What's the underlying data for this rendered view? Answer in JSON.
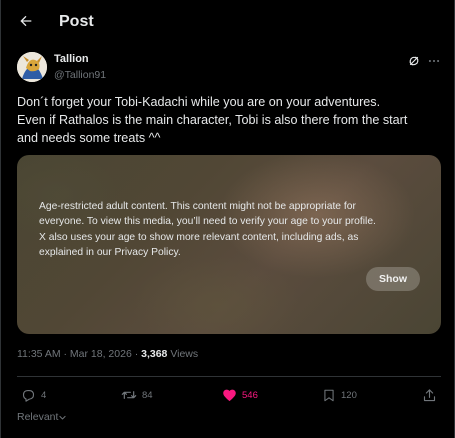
{
  "header": {
    "title": "Post"
  },
  "author": {
    "name": "Tallion",
    "handle": "@Tallion91"
  },
  "tweet": {
    "lines": [
      "Don´t forget your Tobi-Kadachi while you are on your adventures.",
      "Even if Rathalos is the main character, Tobi is also there from the start",
      "and needs some treats ^^"
    ]
  },
  "media": {
    "warning_lines": [
      "Age-restricted adult content. This content might not be appropriate for",
      "everyone. To view this media, you’ll need to verify your age to your profile.",
      "X also uses your age to show more relevant content, including ads, as",
      "explained in our Privacy Policy."
    ],
    "show_label": "Show"
  },
  "meta": {
    "timestamp": "11:35 AM · Mar 18, 2026 · ",
    "views_count": "3,368",
    "views_label": " Views"
  },
  "actions": {
    "replies": "4",
    "reposts": "84",
    "likes": "546",
    "bookmarks": "120"
  },
  "sort": {
    "label": "Relevant"
  },
  "colors": {
    "like": "#f91880",
    "muted": "#71767b",
    "text": "#e7e9ea",
    "background": "#000000"
  },
  "icons": [
    "back-arrow-icon",
    "grok-icon",
    "more-icon",
    "reply-icon",
    "repost-icon",
    "heart-icon",
    "bookmark-icon",
    "share-icon",
    "chevron-down-icon"
  ]
}
